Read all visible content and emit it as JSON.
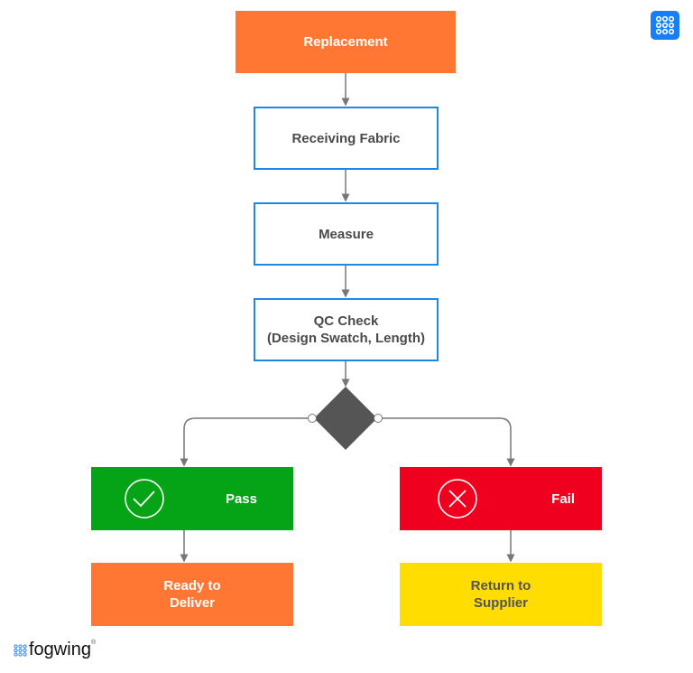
{
  "nodes": {
    "replacement": "Replacement",
    "receiving": "Receiving Fabric",
    "measure": "Measure",
    "qc_line1": "QC Check",
    "qc_line2": "(Design Swatch, Length)",
    "pass": "Pass",
    "fail": "Fail",
    "ready_line1": "Ready to",
    "ready_line2": "Deliver",
    "return_line1": "Return to",
    "return_line2": "Supplier"
  },
  "logo": "fogwing",
  "icons": {
    "pass": "check-circle-icon",
    "fail": "x-circle-icon",
    "app": "grid-dots-icon"
  },
  "colors": {
    "orange": "#FF7733",
    "blue": "#1E88E5",
    "green": "#04A416",
    "red": "#F0001E",
    "yellow": "#FFDD00",
    "diamond": "#555555"
  }
}
